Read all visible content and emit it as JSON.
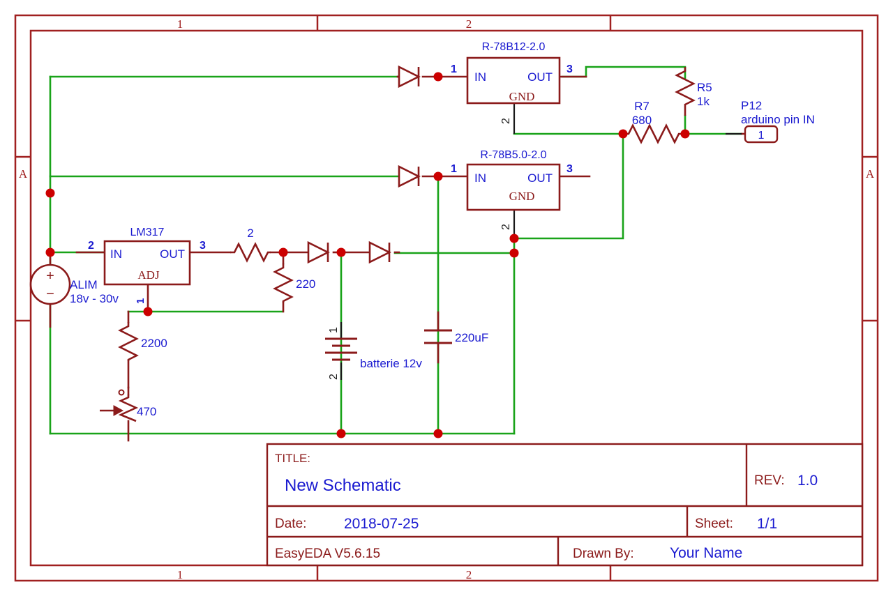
{
  "app": {
    "name": "EasyEDA",
    "version_label": "EasyEDA V5.6.15"
  },
  "colors": {
    "wire_green": "#19a319",
    "symbol_red": "#8b1a1a",
    "label_blue": "#1a1ad0",
    "frame_red": "#a02020",
    "junction_red": "#cc0000",
    "pin_black": "#1a1a1a",
    "background": "#ffffff"
  },
  "frame": {
    "zones_top": [
      "1",
      "2"
    ],
    "zones_bottom": [
      "1",
      "2"
    ],
    "zone_left": "A",
    "zone_right": "A"
  },
  "title_block": {
    "title_label": "TITLE:",
    "title_value": "New Schematic",
    "rev_label": "REV:",
    "rev_value": "1.0",
    "date_label": "Date:",
    "date_value": "2018-07-25",
    "sheet_label": "Sheet:",
    "sheet_value": "1/1",
    "tool_value": "EasyEDA V5.6.15",
    "drawn_by_label": "Drawn By:",
    "drawn_by_value": "Your Name"
  },
  "components": {
    "reg12": {
      "name": "R-78B12-2.0",
      "pin_in_label": "IN",
      "pin_out_label": "OUT",
      "pin_gnd_label": "GND",
      "pin_num_in": "1",
      "pin_num_out": "3",
      "pin_num_gnd": "2"
    },
    "reg5": {
      "name": "R-78B5.0-2.0",
      "pin_in_label": "IN",
      "pin_out_label": "OUT",
      "pin_gnd_label": "GND",
      "pin_num_in": "1",
      "pin_num_out": "3",
      "pin_num_gnd": "2"
    },
    "lm317": {
      "name": "LM317",
      "pin_in_label": "IN",
      "pin_out_label": "OUT",
      "pin_adj_label": "ADJ",
      "pin_num_in": "2",
      "pin_num_out": "3",
      "pin_num_adj": "1"
    },
    "source": {
      "designator": "ALIM",
      "value": "18v - 30v",
      "plus": "+",
      "minus": "−"
    },
    "r5": {
      "designator": "R5",
      "value": "1k"
    },
    "r7": {
      "designator": "R7",
      "value": "680"
    },
    "r_out": {
      "value": "2"
    },
    "r_220": {
      "value": "220"
    },
    "r_2200": {
      "value": "2200"
    },
    "pot_470": {
      "value": "470"
    },
    "battery": {
      "value": "batterie 12v",
      "pin_num_1": "1",
      "pin_num_2": "2"
    },
    "cap_220uf": {
      "value": "220uF"
    },
    "port_p12": {
      "designator": "P12",
      "description": "arduino pin IN",
      "pin_num": "1"
    }
  }
}
